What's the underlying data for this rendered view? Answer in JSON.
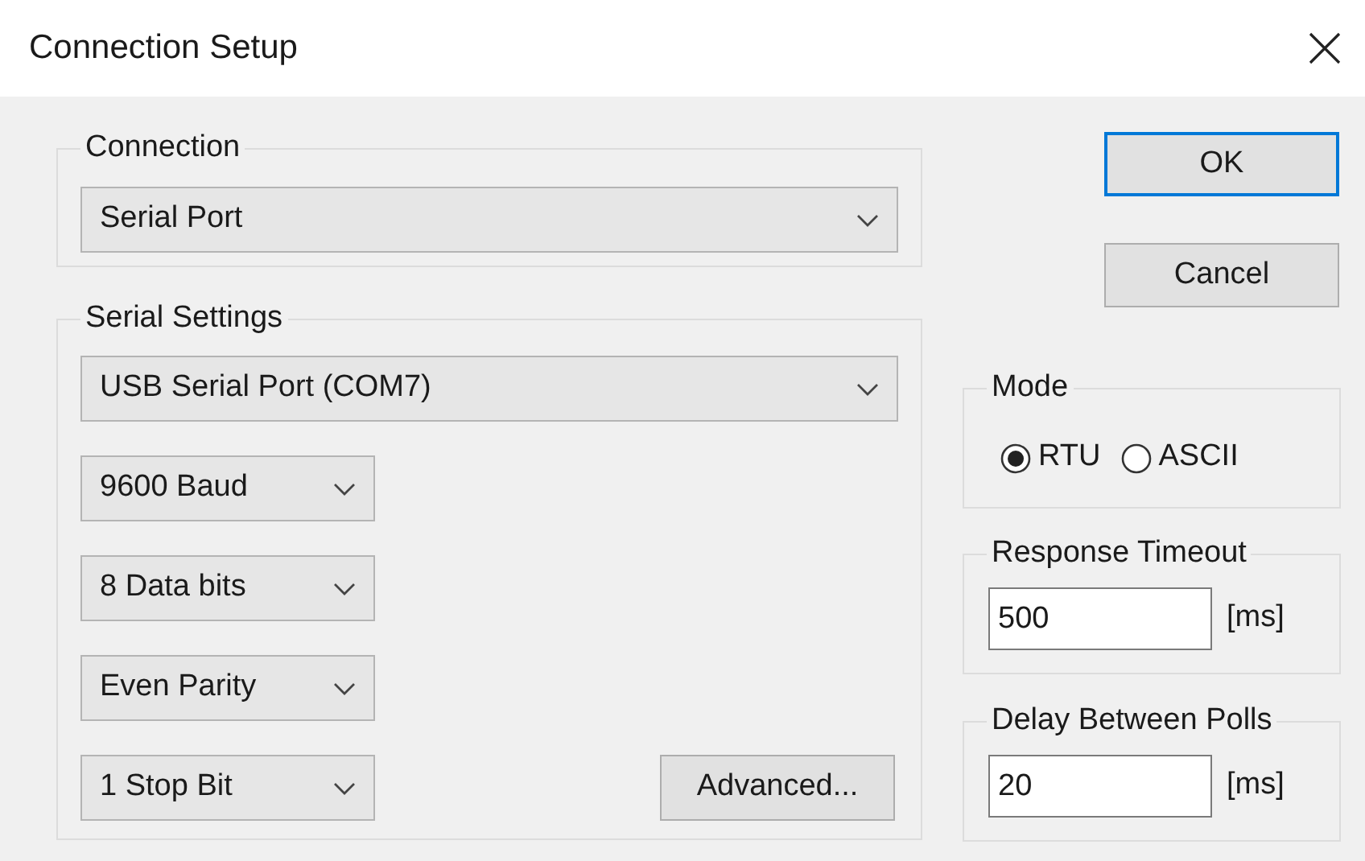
{
  "window": {
    "title": "Connection Setup"
  },
  "connection": {
    "label": "Connection",
    "value": "Serial Port"
  },
  "serial_settings": {
    "label": "Serial Settings",
    "port": "USB Serial Port (COM7)",
    "options": [
      "9600 Baud",
      "8 Data bits",
      "Even Parity",
      "1 Stop Bit"
    ],
    "advanced": "Advanced..."
  },
  "buttons": [
    {
      "label": "OK",
      "default": true
    },
    {
      "label": "Cancel",
      "default": false
    }
  ],
  "mode": {
    "label": "Mode",
    "options": [
      {
        "label": "RTU",
        "selected": true
      },
      {
        "label": "ASCII",
        "selected": false
      }
    ]
  },
  "timeouts": [
    {
      "label": "Response Timeout",
      "value": "500",
      "unit": "[ms]"
    },
    {
      "label": "Delay Between Polls",
      "value": "20",
      "unit": "[ms]"
    }
  ]
}
